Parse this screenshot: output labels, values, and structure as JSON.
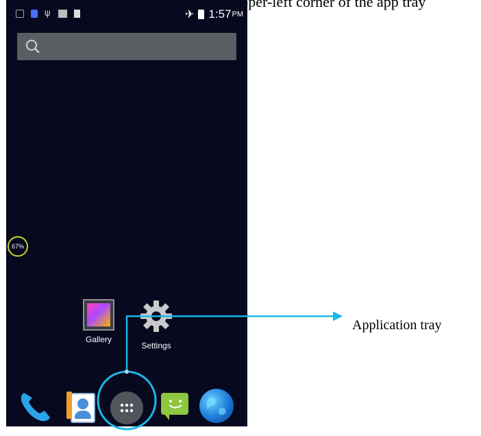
{
  "page": {
    "top_caption": "…ly appears in the upper-left corner of the app tray"
  },
  "status_bar": {
    "left_icons": [
      "battery-percent-icon",
      "phone-icon",
      "usb-icon",
      "picture-icon",
      "signal-icon"
    ],
    "right_icons": [
      "airplane-mode-icon",
      "battery-icon"
    ],
    "time": "1:57",
    "ampm": "PM"
  },
  "search": {
    "icon": "search-icon"
  },
  "widget": {
    "label": "67%",
    "value_percent": 67,
    "ring_color": "#c9d628"
  },
  "home_apps": [
    {
      "label": "Gallery",
      "icon": "gallery-icon"
    },
    {
      "label": "Settings",
      "icon": "gear-icon"
    }
  ],
  "dock": [
    {
      "icon": "phone-icon"
    },
    {
      "icon": "contacts-icon"
    },
    {
      "icon": "app-tray-icon"
    },
    {
      "icon": "messaging-icon"
    },
    {
      "icon": "browser-icon"
    }
  ],
  "callout": {
    "label": "Application tray",
    "color": "#1ab7ea"
  },
  "colors": {
    "screen_bg": "#07091f",
    "search_bg": "#5a5d61",
    "accent": "#1ab7ea"
  }
}
